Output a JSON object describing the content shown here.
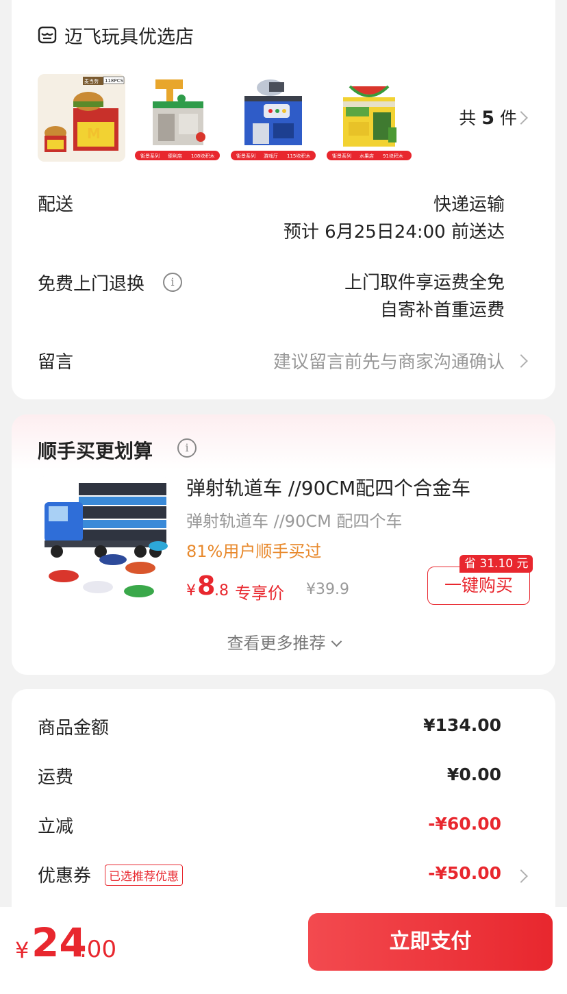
{
  "store": {
    "name": "迈飞玩具优选店",
    "icon": "store-icon"
  },
  "order_items": {
    "thumbs": [
      {
        "name": "mcdonalds-store-toy",
        "box_label": "麦当劳",
        "pcs": "118PCS"
      },
      {
        "name": "convenience-store-toy",
        "tags": [
          "街景系列",
          "便利店",
          "108块积木"
        ]
      },
      {
        "name": "arcade-toy",
        "tags": [
          "街景系列",
          "游戏厅",
          "115块积木"
        ]
      },
      {
        "name": "fruit-store-toy",
        "tags": [
          "街景系列",
          "水果店",
          "91块积木"
        ]
      }
    ],
    "count_prefix": "共",
    "count": "5",
    "count_suffix": "件"
  },
  "delivery": {
    "label": "配送",
    "method": "快递运输",
    "eta": "预计 6月25日24:00 前送达"
  },
  "return": {
    "label": "免费上门退换",
    "line1": "上门取件享运费全免",
    "line2": "自寄补首重运费"
  },
  "message": {
    "label": "留言",
    "placeholder": "建议留言前先与商家沟通确认"
  },
  "recommendation": {
    "title": "顺手买更划算",
    "product_name": "弹射轨道车 //90CM配四个合金车",
    "product_sub": "弹射轨道车 //90CM 配四个车",
    "buy_percent": "81%用户顺手买过",
    "price_symbol": "¥",
    "price_int": "8",
    "price_dec": ".8",
    "price_tag": "专享价",
    "original_price": "¥39.9",
    "save_badge": "省 31.10 元",
    "buy_button": "一键购买",
    "more": "查看更多推荐"
  },
  "summary": {
    "rows": [
      {
        "label": "商品金额",
        "value": "¥134.00"
      },
      {
        "label": "运费",
        "value": "¥0.00"
      },
      {
        "label": "立减",
        "value": "-¥60.00"
      },
      {
        "label": "优惠券",
        "value": "-¥50.00",
        "tag": "已选推荐优惠"
      }
    ]
  },
  "footer": {
    "total_symbol": "¥",
    "total_int": "24",
    "total_dec": ".00",
    "pay_button": "立即支付"
  },
  "colors": {
    "accent": "#e8272e",
    "highlight": "#e8892c"
  }
}
